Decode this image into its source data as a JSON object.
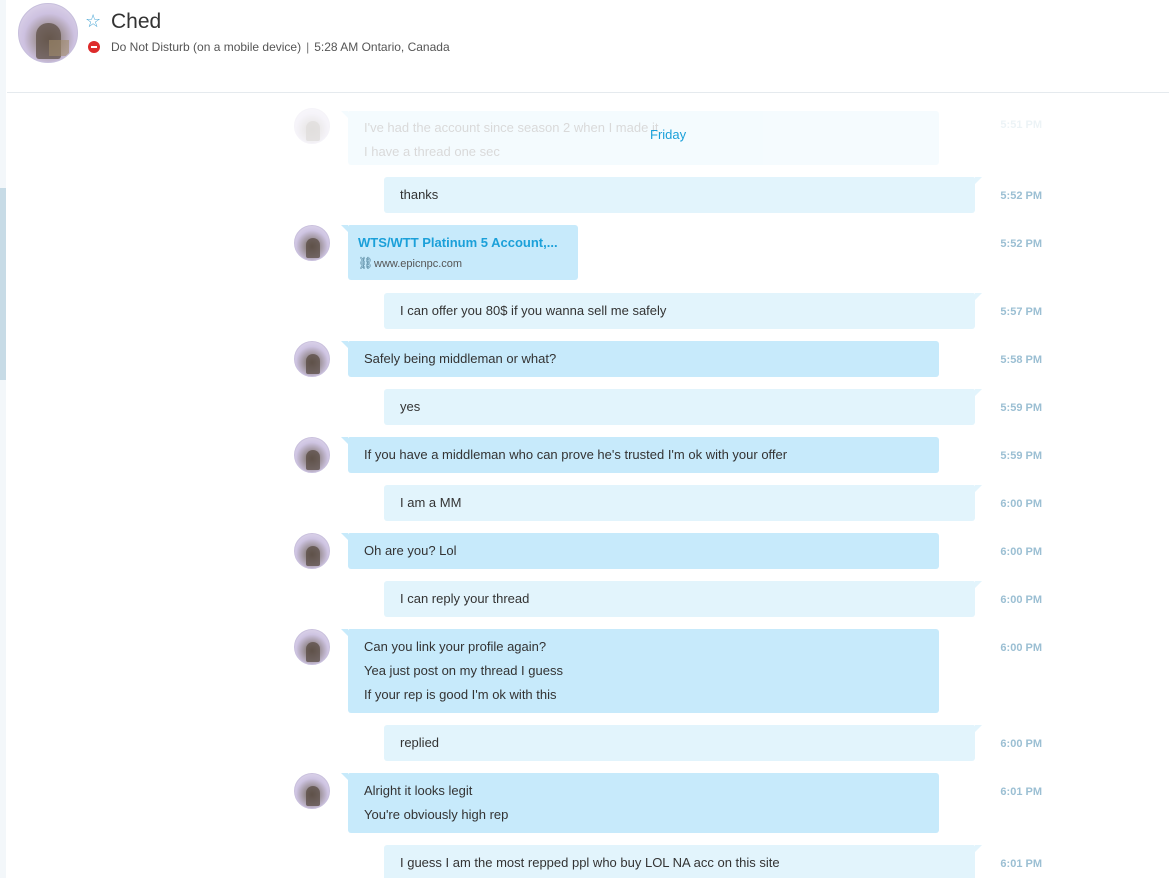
{
  "contact": {
    "name": "Ched",
    "status": "Do Not Disturb (on a mobile device)",
    "local_time": "5:28 AM Ontario, Canada"
  },
  "colors": {
    "accent": "#1ba0d9",
    "received_bubble": "#c7eafb",
    "sent_bubble": "#e2f4fc",
    "dnd": "#dd2b2b"
  },
  "day_divider": "Friday",
  "faded_message": {
    "lines": [
      "I've had the account since season 2 when I made it",
      "I have a thread one sec"
    ],
    "time": "5:51 PM"
  },
  "messages": [
    {
      "lines": [
        "thanks"
      ],
      "time": "5:52 PM"
    },
    {
      "link_title": "WTS/WTT Platinum 5 Account,...",
      "link_url": "www.epicnpc.com",
      "time": "5:52 PM"
    },
    {
      "lines": [
        "I can offer you 80$ if you wanna sell me safely"
      ],
      "time": "5:57 PM"
    },
    {
      "lines": [
        "Safely being middleman or what?"
      ],
      "time": "5:58 PM"
    },
    {
      "lines": [
        "yes"
      ],
      "time": "5:59 PM"
    },
    {
      "lines": [
        "If you have a middleman who can prove he's trusted I'm ok with your offer"
      ],
      "time": "5:59 PM"
    },
    {
      "lines": [
        "I am a MM"
      ],
      "time": "6:00 PM"
    },
    {
      "lines": [
        "Oh are you? Lol"
      ],
      "time": "6:00 PM"
    },
    {
      "lines": [
        "I can reply your thread"
      ],
      "time": "6:00 PM"
    },
    {
      "lines": [
        "Can you link your profile again?",
        "Yea just post on my thread I guess",
        "If your rep is good I'm ok with this"
      ],
      "time": "6:00 PM"
    },
    {
      "lines": [
        "replied"
      ],
      "time": "6:00 PM"
    },
    {
      "lines": [
        "Alright it looks legit",
        "You're obviously high rep"
      ],
      "time": "6:01 PM"
    },
    {
      "lines": [
        "I guess I am the most repped ppl who buy LOL NA acc on this site"
      ],
      "time": "6:01 PM"
    }
  ]
}
